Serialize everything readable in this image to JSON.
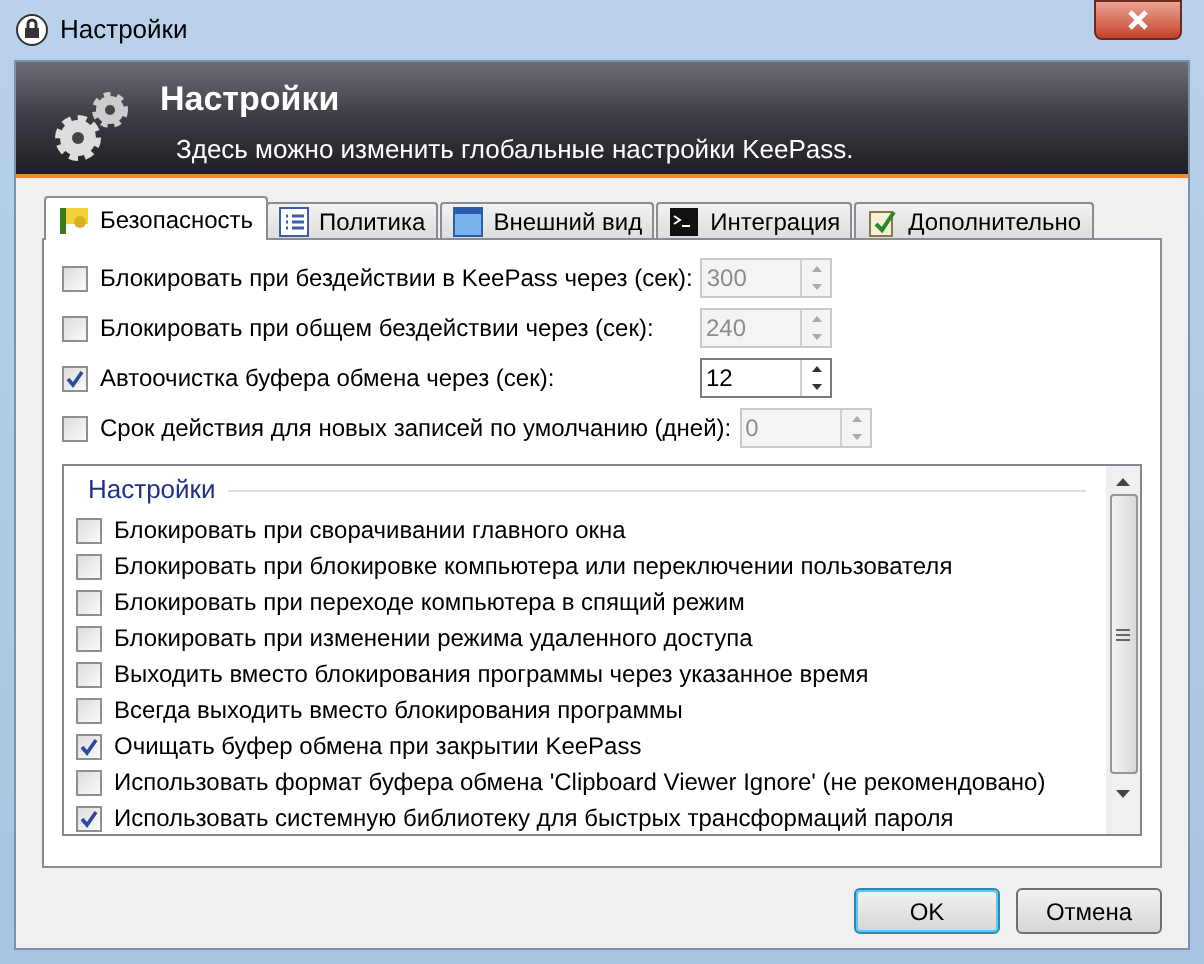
{
  "window": {
    "title": "Настройки"
  },
  "header": {
    "title": "Настройки",
    "subtitle": "Здесь можно изменить глобальные настройки KeePass."
  },
  "tabs": [
    {
      "label": "Безопасность",
      "selected": true
    },
    {
      "label": "Политика",
      "selected": false
    },
    {
      "label": "Внешний вид",
      "selected": false
    },
    {
      "label": "Интеграция",
      "selected": false
    },
    {
      "label": "Дополнительно",
      "selected": false
    }
  ],
  "timeouts": [
    {
      "label": "Блокировать при бездействии в KeePass через (сек):",
      "checked": false,
      "value": "300",
      "disabled": true
    },
    {
      "label": "Блокировать при общем бездействии через (сек):",
      "checked": false,
      "value": "240",
      "disabled": true
    },
    {
      "label": "Автоочистка буфера обмена через (сек):",
      "checked": true,
      "value": "12",
      "disabled": false
    },
    {
      "label": "Срок действия для новых записей по умолчанию (дней):",
      "checked": false,
      "value": "0",
      "disabled": true
    }
  ],
  "options": {
    "title": "Настройки",
    "items": [
      {
        "label": "Блокировать при сворачивании главного окна",
        "checked": false
      },
      {
        "label": "Блокировать при блокировке компьютера или переключении пользователя",
        "checked": false
      },
      {
        "label": "Блокировать при переходе компьютера в спящий режим",
        "checked": false
      },
      {
        "label": "Блокировать при изменении режима удаленного доступа",
        "checked": false
      },
      {
        "label": "Выходить вместо блокирования программы через указанное время",
        "checked": false
      },
      {
        "label": "Всегда выходить вместо блокирования программы",
        "checked": false
      },
      {
        "label": "Очищать буфер обмена при закрытии KeePass",
        "checked": true
      },
      {
        "label": "Использовать формат буфера обмена 'Clipboard Viewer Ignore' (не рекомендовано)",
        "checked": false
      },
      {
        "label": "Использовать системную библиотеку для быстрых трансформаций пароля",
        "checked": true
      }
    ]
  },
  "buttons": [
    "OK",
    "Отмена"
  ]
}
